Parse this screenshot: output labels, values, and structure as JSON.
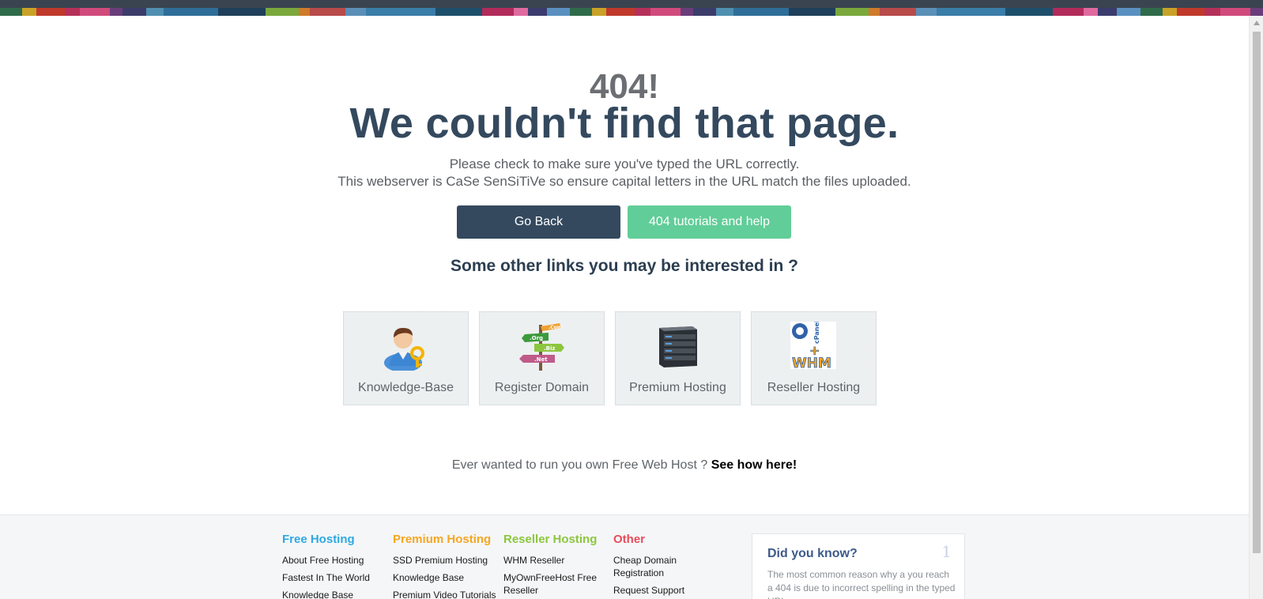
{
  "colors": {
    "primary_dark": "#34495e",
    "accent_green": "#61cd98",
    "free_hosting": "#2fa8e3",
    "premium_hosting": "#f5a623",
    "reseller_hosting": "#8cc63f",
    "other": "#e84c5b",
    "stripe": [
      "#2f6b4a",
      "#c9a227",
      "#c0392b",
      "#b5305a",
      "#d04a7c",
      "#6a3d7a",
      "#3c3c6b",
      "#4f8fb0",
      "#2e6e99",
      "#1f3f5a",
      "#7aa83c",
      "#d07a2b",
      "#b84a4a",
      "#5a8fb8",
      "#3a7da8",
      "#1d4f6b",
      "#b22b5b",
      "#e06aa0",
      "#3b3b6d",
      "#5990c0"
    ]
  },
  "error": {
    "code": "404!",
    "title": "We couldn't find that page.",
    "line1": "Please check to make sure you've typed the URL correctly.",
    "line2": "This webserver is CaSe SenSiTiVe so ensure capital letters in the URL match the files uploaded."
  },
  "buttons": {
    "go_back": "Go Back",
    "tutorials": "404 tutorials and help"
  },
  "links_heading": "Some other links you may be interested in ?",
  "tiles": [
    {
      "label": "Knowledge-Base",
      "icon": "person-key-icon"
    },
    {
      "label": "Register Domain",
      "icon": "domain-signpost-icon"
    },
    {
      "label": "Premium Hosting",
      "icon": "server-icon"
    },
    {
      "label": "Reseller Hosting",
      "icon": "cpanel-whm-icon"
    }
  ],
  "cpanel_logo": {
    "top": "cPanel",
    "plus": "+",
    "bottom": "WHM"
  },
  "signpost_logo": {
    "a": ".Com",
    "b": ".Org",
    "c": ".Biz",
    "d": ".Net"
  },
  "promo": {
    "text": "Ever wanted to run you own Free Web Host ?",
    "link": "See how here!"
  },
  "footer": {
    "free_hosting": {
      "title": "Free Hosting",
      "links": [
        "About Free Hosting",
        "Fastest In The World",
        "Knowledge Base"
      ]
    },
    "premium_hosting": {
      "title": "Premium Hosting",
      "links": [
        "SSD Premium Hosting",
        "Knowledge Base",
        "Premium Video Tutorials"
      ]
    },
    "reseller_hosting": {
      "title": "Reseller Hosting",
      "links": [
        "WHM Reseller",
        "MyOwnFreeHost Free Reseller"
      ]
    },
    "other": {
      "title": "Other",
      "links": [
        "Cheap Domain Registration",
        "Request Support"
      ]
    },
    "did_you_know": {
      "title": "Did you know?",
      "number": "1",
      "text": "The most common reason why a you reach a 404 is due to incorrect spelling in the typed URL."
    }
  }
}
